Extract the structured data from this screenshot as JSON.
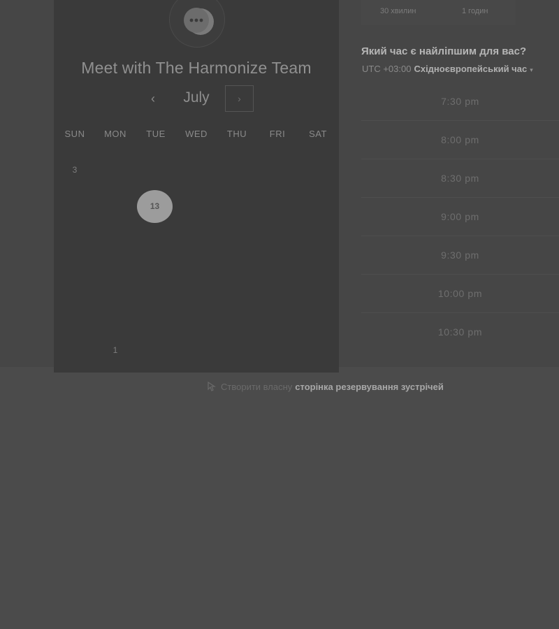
{
  "header": {
    "title": "Meet with The Harmonize Team"
  },
  "calendar": {
    "month": "July",
    "prev_icon": "‹",
    "next_icon": "›",
    "weekdays": [
      "SUN",
      "MON",
      "TUE",
      "WED",
      "THU",
      "FRI",
      "SAT"
    ],
    "days": {
      "d3": "3",
      "d13": "13",
      "d1": "1"
    },
    "selected_day": "13"
  },
  "duration": {
    "option1": "30 хвилин",
    "option2": "1 годин"
  },
  "scheduler": {
    "question": "Який час є найліпшим для вас?",
    "timezone_offset": "UTC +03:00",
    "timezone_name": "Східноєвропейський час",
    "timezone_caret": "▾"
  },
  "slots": [
    "7:30 pm",
    "8:00 pm",
    "8:30 pm",
    "9:00 pm",
    "9:30 pm",
    "10:00 pm",
    "10:30 pm"
  ],
  "footer": {
    "prefix": "Створити власну",
    "link": "сторінка резервування зустрічей"
  },
  "colors": {
    "overlay": "#4b4b4b",
    "panel": "#3a3a3a",
    "selected_day": "#9c9c9c"
  },
  "icons": {
    "logo": "chat-bubble-logo-icon",
    "prev": "chevron-left-icon",
    "next": "chevron-right-icon",
    "timezone": "caret-down-icon",
    "footer": "pointer-icon"
  }
}
